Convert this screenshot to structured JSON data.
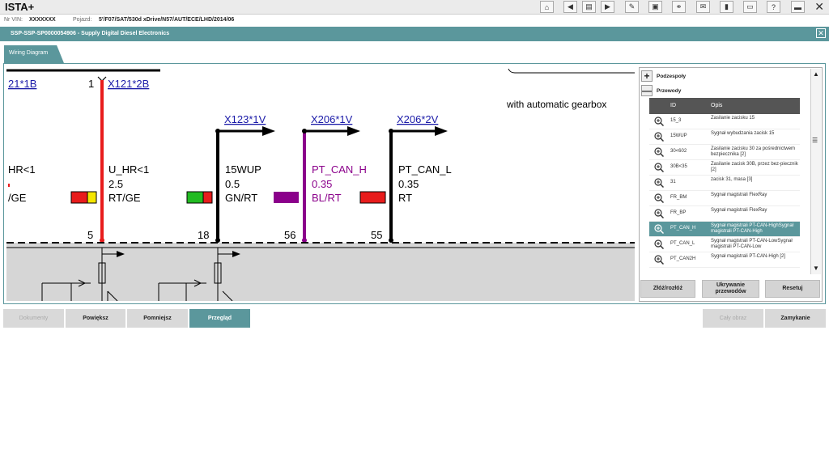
{
  "app": {
    "title": "ISTA+"
  },
  "toolbar": {
    "icons": [
      "home-icon",
      "back-icon",
      "doc-icon",
      "forward-icon",
      "wrench-icon",
      "book-icon",
      "link-icon",
      "mail-icon",
      "battery-icon",
      "print-icon",
      "help-icon",
      "window-icon",
      "close-icon"
    ]
  },
  "info": {
    "vin_label": "Nr VIN:",
    "vin_value": "XXXXXXX",
    "vehicle_label": "Pojazd:",
    "vehicle_value": "5'/F07/SAT/530d xDrive/N57/AUT/ECE/LHD/2014/06"
  },
  "ssp": {
    "title": "SSP-SSP-SP0000054906  -  Supply Digital Diesel Electronics"
  },
  "tab": {
    "label": "Wiring Diagram"
  },
  "diagram": {
    "note": "with automatic gearbox",
    "connectors": [
      "21*1B",
      "X121*2B",
      "X123*1V",
      "X206*1V",
      "X206*2V"
    ],
    "pin_top": "1",
    "wires": [
      {
        "name": "HR<1",
        "size": "",
        "color": "/GE"
      },
      {
        "name": "U_HR<1",
        "size": "2.5",
        "color": "RT/GE"
      },
      {
        "name": "15WUP",
        "size": "0.5",
        "color": "GN/RT"
      },
      {
        "name": "PT_CAN_H",
        "size": "0.35",
        "color": "BL/RT"
      },
      {
        "name": "PT_CAN_L",
        "size": "0.35",
        "color": "RT"
      }
    ],
    "pins": [
      "5",
      "18",
      "56",
      "55"
    ],
    "colors": {
      "red": "#e81c1c",
      "purple": "#8b008b",
      "green": "#22bb22",
      "yellow": "#f5e600",
      "link": "#1a1aa8"
    }
  },
  "panel": {
    "tree": [
      {
        "symbol": "+",
        "label": "Podzespoły"
      },
      {
        "symbol": "—",
        "label": "Przewody"
      }
    ],
    "columns": [
      "ID",
      "Opis"
    ],
    "rows": [
      {
        "id": "15_3",
        "desc": "Zasilanie zacisku 15"
      },
      {
        "id": "15WUP",
        "desc": "Sygnał wybudzania zacisk 15"
      },
      {
        "id": "30<602",
        "desc": "Zasilanie zacisku 30 za pośrednictwem bezpiecznika [2]"
      },
      {
        "id": "30B<35",
        "desc": "Zasilanie zacisk 30B, przez bez-piecznik [2]"
      },
      {
        "id": "31",
        "desc": "zacisk 31, masa [3]"
      },
      {
        "id": "FR_BM",
        "desc": "Sygnał magistrali FlexRay"
      },
      {
        "id": "FR_BP",
        "desc": "Sygnał magistrali FlexRay"
      },
      {
        "id": "PT_CAN_H",
        "desc": "Sygnał magistrali PT-CAN-HighSygnał magistrali PT-CAN-High"
      },
      {
        "id": "PT_CAN_L",
        "desc": "Sygnał magistrali PT-CAN-LowSygnał magistrali PT-CAN-Low"
      },
      {
        "id": "PT_CAN2H",
        "desc": "Sygnał magistrali PT-CAN-High [2]"
      }
    ],
    "buttons": [
      "Złóż/rozłóż",
      "Ukrywanie przewodów",
      "Resetuj"
    ]
  },
  "bottom": {
    "left": [
      "Dokumenty",
      "Powiększ",
      "Pomniejsz",
      "Przegląd"
    ],
    "right": [
      "Cały obraz",
      "Zamykanie"
    ]
  }
}
